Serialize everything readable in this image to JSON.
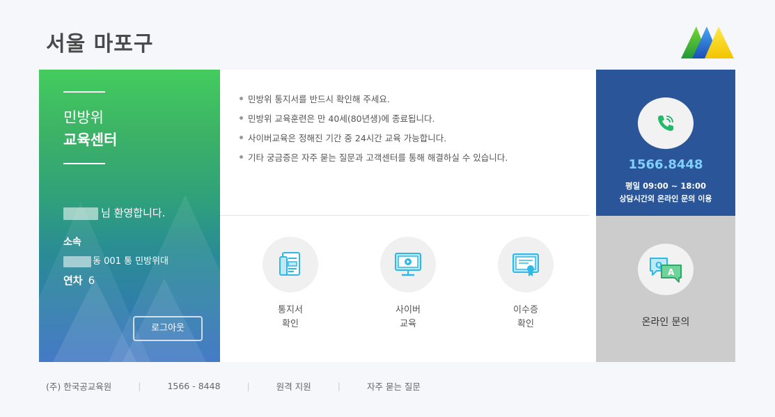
{
  "header": {
    "title": "서울 마포구",
    "logo": "triangle-logo-icon"
  },
  "center": {
    "line1": "민방위",
    "line2": "교육센터"
  },
  "user": {
    "welcome_suffix": "님 환영합니다.",
    "affiliation_label": "소속",
    "affiliation_value": "동 001 통 민방위대",
    "year_label": "연차",
    "year_value": "6",
    "logout_label": "로그아웃"
  },
  "notices": [
    "민방위 통지서를 반드시 확인해 주세요.",
    "민방위 교육훈련은 만 40세(80년생)에 종료됩니다.",
    "사이버교육은 정해진 기간 중 24시간 교육 가능합니다.",
    "기타 궁금증은 자주 묻는 질문과 고객센터를 통해 해결하실 수 있습니다."
  ],
  "services": [
    {
      "icon": "notice-document-icon",
      "line1": "통지서",
      "line2": "확인"
    },
    {
      "icon": "cyber-monitor-icon",
      "line1": "사이버",
      "line2": "교육"
    },
    {
      "icon": "certificate-icon",
      "line1": "이수증",
      "line2": "확인"
    }
  ],
  "call_center": {
    "icon": "phone-call-icon",
    "phone": "1566.8448",
    "hours": "평일 09:00 ~ 18:00",
    "after_hours": "상담시간외 온라인 문의 이용"
  },
  "inquiry": {
    "icon": "qa-chat-icon",
    "label": "온라인 문의"
  },
  "footer": {
    "company": "(주) 한국공교육원",
    "phone": "1566 - 8448",
    "remote": "원격 지원",
    "faq": "자주 묻는 질문"
  },
  "colors": {
    "left_gradient_top": "#44cc5e",
    "left_gradient_bottom": "#3670c2",
    "call_panel": "#2a5599",
    "phone_number": "#7fd0ff",
    "inquiry_panel": "#cccccc",
    "icon_accent": "#2fb8e6"
  }
}
